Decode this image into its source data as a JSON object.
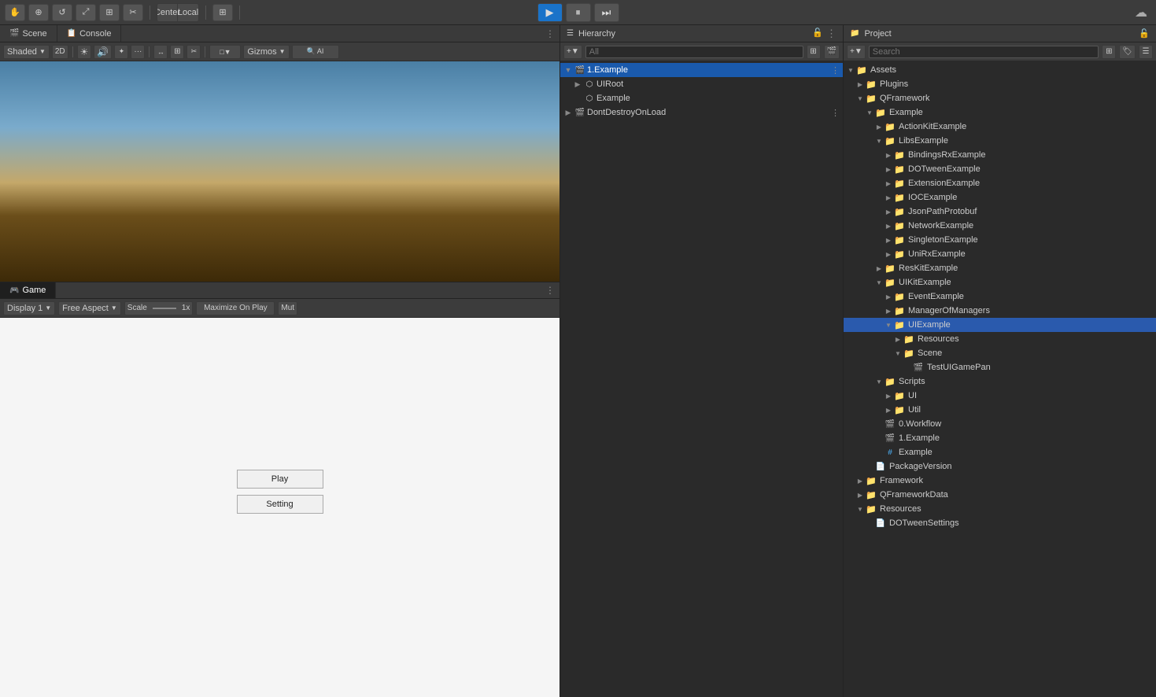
{
  "topbar": {
    "play_label": "▶",
    "pause_label": "⏸",
    "step_label": "⏭",
    "cloud_label": "☁",
    "tools": [
      "✋",
      "⊕",
      "↺",
      "⤢",
      "⊞",
      "✂"
    ],
    "center_label": "Center",
    "local_label": "Local",
    "grid_label": "⊞"
  },
  "scene_panel": {
    "tab_label": "Scene",
    "tab_icon": "🎬",
    "shaded_label": "Shaded",
    "twod_label": "2D",
    "gizmos_label": "Gizmos"
  },
  "game_panel": {
    "tab_label": "Game",
    "tab_icon": "🎮",
    "display_label": "Display 1",
    "aspect_label": "Free Aspect",
    "scale_label": "Scale",
    "scale_value": "1x",
    "maximize_label": "Maximize On Play",
    "mute_label": "Mut",
    "menu_dots": "⋮"
  },
  "hierarchy_panel": {
    "title": "Hierarchy",
    "search_placeholder": "All",
    "items": [
      {
        "id": "example1",
        "label": "1.Example",
        "indent": 0,
        "arrow": "▼",
        "icon": "🎬",
        "selected": true
      },
      {
        "id": "uiroot",
        "label": "UIRoot",
        "indent": 1,
        "arrow": "▶",
        "icon": "⬡"
      },
      {
        "id": "example",
        "label": "Example",
        "indent": 1,
        "arrow": "",
        "icon": "⬡"
      },
      {
        "id": "dontdestroy",
        "label": "DontDestroyOnLoad",
        "indent": 0,
        "arrow": "▶",
        "icon": "🎬"
      }
    ]
  },
  "project_panel": {
    "title": "Project",
    "items": [
      {
        "id": "assets",
        "label": "Assets",
        "indent": 0,
        "arrow": "▼",
        "icon": "📁",
        "open": true
      },
      {
        "id": "plugins",
        "label": "Plugins",
        "indent": 1,
        "arrow": "▶",
        "icon": "📁"
      },
      {
        "id": "qframework",
        "label": "QFramework",
        "indent": 1,
        "arrow": "▼",
        "icon": "📁",
        "open": true
      },
      {
        "id": "example-qf",
        "label": "Example",
        "indent": 2,
        "arrow": "▼",
        "icon": "📁",
        "open": true
      },
      {
        "id": "actionkitexample",
        "label": "ActionKitExample",
        "indent": 3,
        "arrow": "▶",
        "icon": "📁"
      },
      {
        "id": "libsexample",
        "label": "LibsExample",
        "indent": 3,
        "arrow": "▼",
        "icon": "📁",
        "open": true
      },
      {
        "id": "bindingsrxexample",
        "label": "BindingsRxExample",
        "indent": 4,
        "arrow": "▶",
        "icon": "📁"
      },
      {
        "id": "dotweenexample",
        "label": "DOTweenExample",
        "indent": 4,
        "arrow": "▶",
        "icon": "📁"
      },
      {
        "id": "extensionexample",
        "label": "ExtensionExample",
        "indent": 4,
        "arrow": "▶",
        "icon": "📁"
      },
      {
        "id": "iocexample",
        "label": "IOCExample",
        "indent": 4,
        "arrow": "▶",
        "icon": "📁"
      },
      {
        "id": "jsonpathprotobuf",
        "label": "JsonPathProtobuf",
        "indent": 4,
        "arrow": "▶",
        "icon": "📁"
      },
      {
        "id": "networkexample",
        "label": "NetworkExample",
        "indent": 4,
        "arrow": "▶",
        "icon": "📁"
      },
      {
        "id": "singletonexample",
        "label": "SingletonExample",
        "indent": 4,
        "arrow": "▶",
        "icon": "📁"
      },
      {
        "id": "unirxexample",
        "label": "UniRxExample",
        "indent": 4,
        "arrow": "▶",
        "icon": "📁"
      },
      {
        "id": "reskitexample",
        "label": "ResKitExample",
        "indent": 3,
        "arrow": "▶",
        "icon": "📁"
      },
      {
        "id": "uikitexample",
        "label": "UIKitExample",
        "indent": 3,
        "arrow": "▼",
        "icon": "📁",
        "open": true
      },
      {
        "id": "eventexample",
        "label": "EventExample",
        "indent": 4,
        "arrow": "▶",
        "icon": "📁"
      },
      {
        "id": "managerofmanagers",
        "label": "ManagerOfManagers",
        "indent": 4,
        "arrow": "▶",
        "icon": "📁"
      },
      {
        "id": "uiexample",
        "label": "UIExample",
        "indent": 4,
        "arrow": "▼",
        "icon": "📁",
        "open": true
      },
      {
        "id": "resources",
        "label": "Resources",
        "indent": 5,
        "arrow": "▶",
        "icon": "📁"
      },
      {
        "id": "scene-folder",
        "label": "Scene",
        "indent": 5,
        "arrow": "▼",
        "icon": "📁",
        "open": true
      },
      {
        "id": "testuigamepan",
        "label": "TestUIGamePan",
        "indent": 6,
        "arrow": "",
        "icon": "🎬",
        "scene": true
      },
      {
        "id": "scripts",
        "label": "Scripts",
        "indent": 3,
        "arrow": "▼",
        "icon": "📁",
        "open": true
      },
      {
        "id": "ui-folder",
        "label": "UI",
        "indent": 4,
        "arrow": "▶",
        "icon": "📁"
      },
      {
        "id": "util-folder",
        "label": "Util",
        "indent": 4,
        "arrow": "▶",
        "icon": "📁"
      },
      {
        "id": "workflow",
        "label": "0.Workflow",
        "indent": 3,
        "arrow": "",
        "icon": "🎬",
        "scene": true
      },
      {
        "id": "example1-proj",
        "label": "1.Example",
        "indent": 3,
        "arrow": "",
        "icon": "🎬",
        "scene": true
      },
      {
        "id": "example-cs",
        "label": "Example",
        "indent": 3,
        "arrow": "",
        "icon": "#",
        "script": true
      },
      {
        "id": "packageversion",
        "label": "PackageVersion",
        "indent": 2,
        "arrow": "",
        "icon": "📄"
      },
      {
        "id": "framework",
        "label": "Framework",
        "indent": 1,
        "arrow": "▶",
        "icon": "📁"
      },
      {
        "id": "qframeworkdata",
        "label": "QFrameworkData",
        "indent": 1,
        "arrow": "▶",
        "icon": "📁"
      },
      {
        "id": "resources-root",
        "label": "Resources",
        "indent": 1,
        "arrow": "▼",
        "icon": "📁",
        "open": true
      },
      {
        "id": "dotweensettings",
        "label": "DOTweenSettings",
        "indent": 2,
        "arrow": "",
        "icon": "📄"
      }
    ]
  },
  "game_view": {
    "play_btn_label": "Play",
    "setting_btn_label": "Setting"
  },
  "console_tab": {
    "label": "Console",
    "icon": "📋"
  }
}
